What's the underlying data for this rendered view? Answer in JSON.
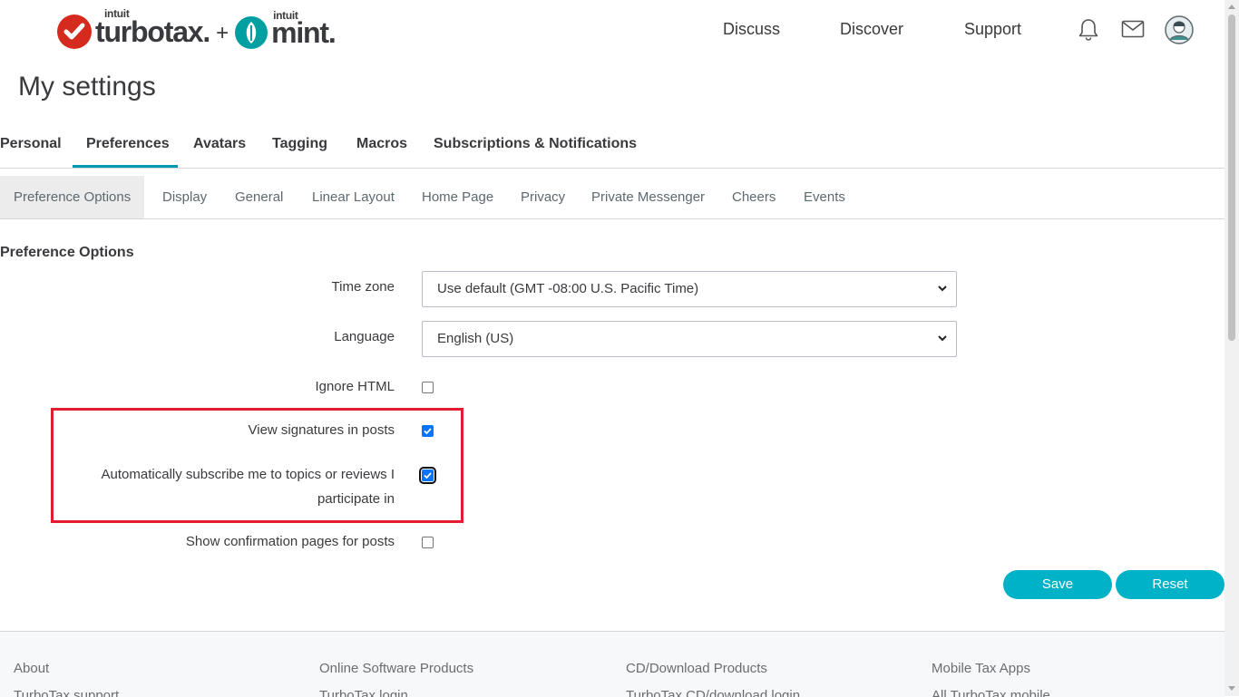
{
  "brand": {
    "intuit_1": "intuit",
    "turbotax": "turbotax.",
    "plus": "+",
    "intuit_2": "intuit",
    "mint": "mint."
  },
  "nav": {
    "discuss": "Discuss",
    "discover": "Discover",
    "support": "Support"
  },
  "header_icons": [
    "bell-icon",
    "mail-icon",
    "user-avatar"
  ],
  "page_title": "My settings",
  "tabs": [
    "Personal",
    "Preferences",
    "Avatars",
    "Tagging",
    "Macros",
    "Subscriptions & Notifications"
  ],
  "active_tab": "Preferences",
  "subtabs": [
    "Preference Options",
    "Display",
    "General",
    "Linear Layout",
    "Home Page",
    "Privacy",
    "Private Messenger",
    "Cheers",
    "Events"
  ],
  "active_subtab": "Preference Options",
  "section_title": "Preference Options",
  "form": {
    "timezone": {
      "label": "Time zone",
      "value": "Use default (GMT -08:00 U.S. Pacific Time)"
    },
    "language": {
      "label": "Language",
      "value": "English (US)"
    },
    "ignore_html": {
      "label": "Ignore HTML",
      "checked": false
    },
    "view_signatures": {
      "label": "View signatures in posts",
      "checked": true
    },
    "auto_subscribe": {
      "label": "Automatically subscribe me to topics or reviews I participate in",
      "checked": true
    },
    "show_confirmation": {
      "label": "Show confirmation pages for posts",
      "checked": false
    }
  },
  "buttons": {
    "save": "Save",
    "reset": "Reset"
  },
  "footer": {
    "columns": [
      {
        "title": "About",
        "first_link": "TurboTax support"
      },
      {
        "title": "Online Software Products",
        "first_link": "TurboTax login"
      },
      {
        "title": "CD/Download Products",
        "first_link": "TurboTax CD/download login"
      },
      {
        "title": "Mobile Tax Apps",
        "first_link": "All TurboTax mobile"
      }
    ]
  },
  "colors": {
    "accent": "#0097b1",
    "button": "#00b2c8",
    "highlight": "#e21d2f",
    "turbotax_red": "#d52b1e",
    "mint_teal": "#00a0a2"
  }
}
